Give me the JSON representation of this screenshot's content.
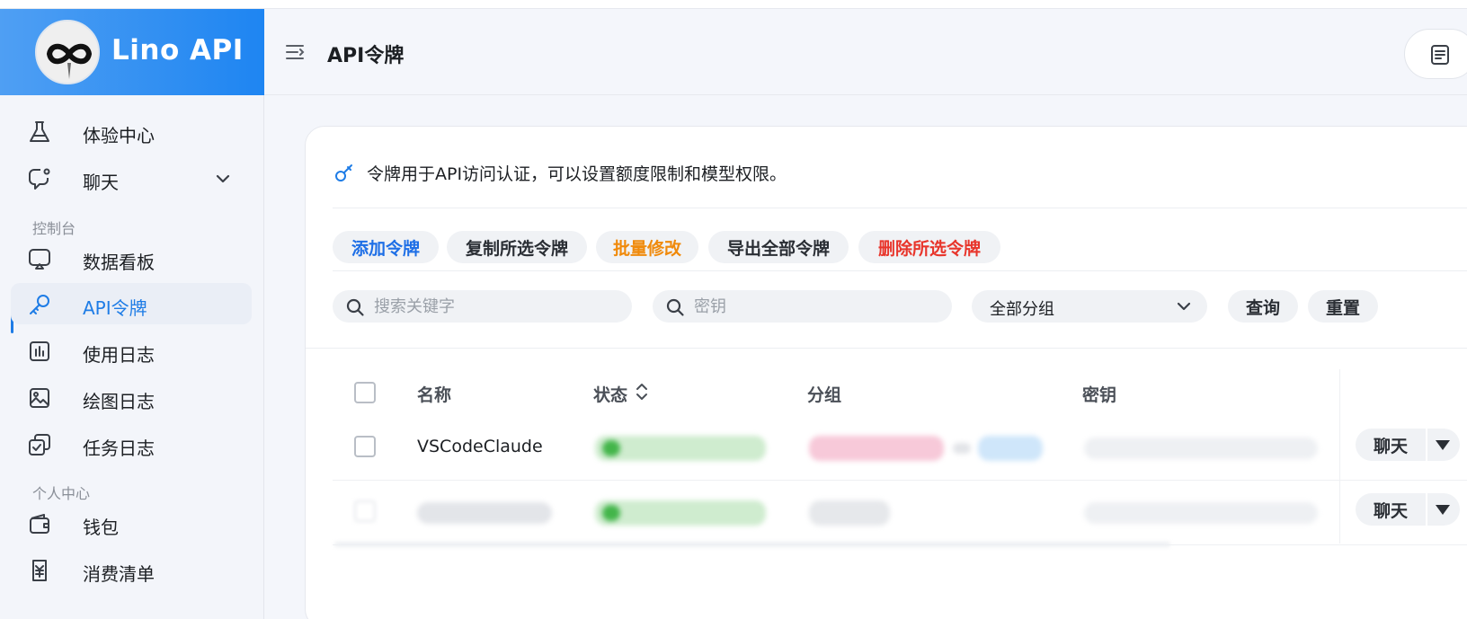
{
  "brand": {
    "title": "Lino API"
  },
  "sidebar": {
    "items": [
      {
        "label": "体验中心",
        "icon": "flask-icon"
      },
      {
        "label": "聊天",
        "icon": "chat-bubble-icon"
      },
      {
        "label": "数据看板",
        "icon": "dashboard-icon"
      },
      {
        "label": "API令牌",
        "icon": "key-icon"
      },
      {
        "label": "使用日志",
        "icon": "usage-log-icon"
      },
      {
        "label": "绘图日志",
        "icon": "image-icon"
      },
      {
        "label": "任务日志",
        "icon": "task-icon"
      },
      {
        "label": "钱包",
        "icon": "wallet-icon"
      },
      {
        "label": "消费清单",
        "icon": "bill-icon"
      }
    ],
    "sections": {
      "console": "控制台",
      "personal": "个人中心"
    }
  },
  "header": {
    "title": "API令牌"
  },
  "card": {
    "info": "令牌用于API访问认证，可以设置额度限制和模型权限。",
    "actions": {
      "add": "添加令牌",
      "copy": "复制所选令牌",
      "batch_edit": "批量修改",
      "export": "导出全部令牌",
      "delete": "删除所选令牌"
    },
    "filters": {
      "keyword_placeholder": "搜索关键字",
      "key_placeholder": "密钥",
      "group_value": "全部分组",
      "query": "查询",
      "reset": "重置"
    },
    "table": {
      "headers": {
        "name": "名称",
        "status": "状态",
        "group": "分组",
        "key": "密钥"
      },
      "rows": [
        {
          "name": "VSCodeClaude",
          "action": "聊天"
        },
        {
          "name": "",
          "action": "聊天"
        }
      ]
    }
  },
  "colors": {
    "brand": "#1e85f2",
    "accent_blue": "#1e6fe6",
    "accent_orange": "#f08a0b",
    "accent_red": "#e8352b"
  }
}
